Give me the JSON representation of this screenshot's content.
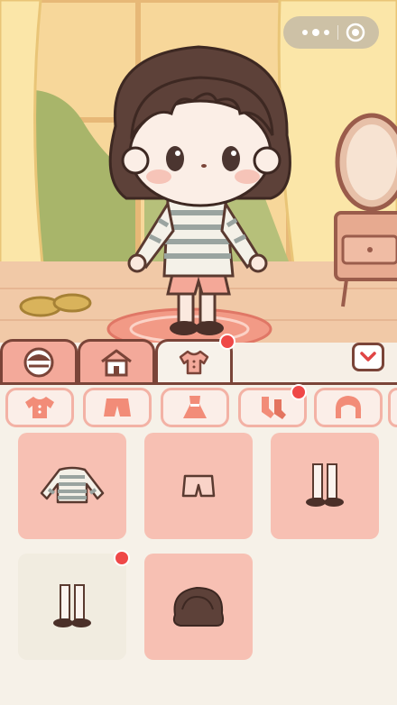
{
  "scene": {
    "character": "girl-with-bob-haircut",
    "colors": {
      "wall": "#f3dcb3",
      "curtain": "#fbe6a8",
      "floor": "#f1c9a7",
      "rug": "#f29a86"
    }
  },
  "mini_program_capsule": {
    "more_icon": "more-dots-icon",
    "close_icon": "target-icon"
  },
  "main_tabs": [
    {
      "icon": "face-icon",
      "active": false
    },
    {
      "icon": "house-icon",
      "active": false
    },
    {
      "icon": "shirt-icon",
      "active": true,
      "badge": true
    }
  ],
  "collapse_icon": "chevron-down-icon",
  "categories": [
    {
      "icon": "top-icon"
    },
    {
      "icon": "shorts-icon"
    },
    {
      "icon": "dress-icon"
    },
    {
      "icon": "socks-icon",
      "badge": true
    },
    {
      "icon": "hair-icon"
    }
  ],
  "items": [
    {
      "icon": "striped-shirt-icon",
      "selected": false
    },
    {
      "icon": "shorts-outline-icon",
      "selected": false
    },
    {
      "icon": "socks-shoes-icon",
      "selected": false
    },
    {
      "icon": "socks-shoes-icon",
      "selected": true,
      "badge": true
    },
    {
      "icon": "bob-hair-icon",
      "selected": false
    }
  ],
  "colors": {
    "accent": "#7a4438",
    "tab": "#f3a99a",
    "card": "#f7c0b3",
    "badge": "#ef4848"
  }
}
